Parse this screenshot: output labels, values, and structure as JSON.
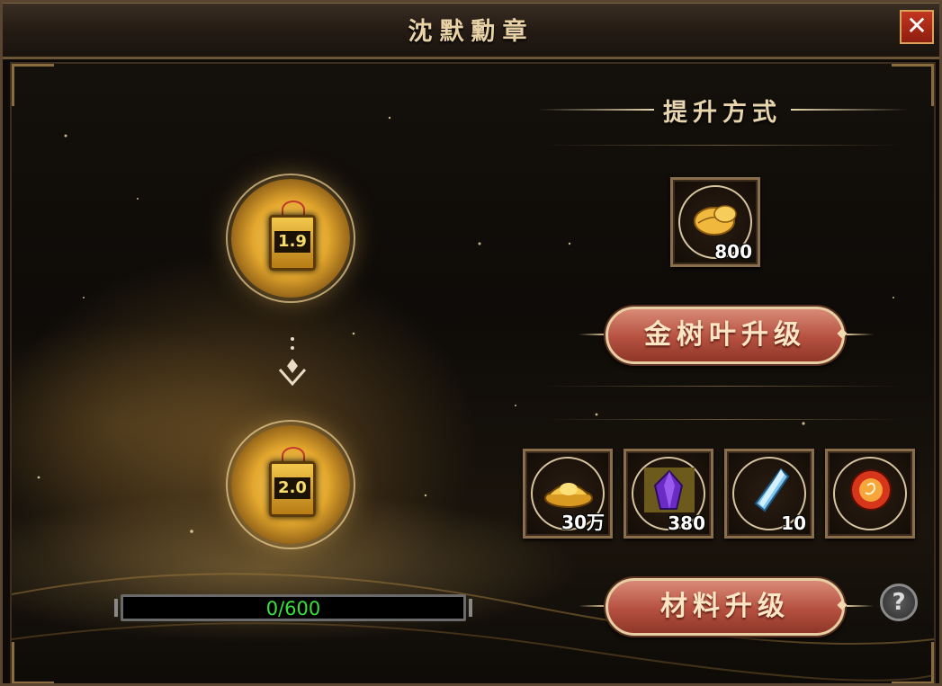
{
  "window": {
    "title": "沈默勳章",
    "close_label": "✕"
  },
  "medal": {
    "current_level": "1.9",
    "next_level": "2.0"
  },
  "progress": {
    "text": "0/600",
    "current": 0,
    "max": 600
  },
  "upgrade_section": {
    "title": "提升方式"
  },
  "gold_leaf": {
    "icon": "gold-leaf-icon",
    "quantity": "800",
    "button_label": "金树叶升级"
  },
  "materials": {
    "items": [
      {
        "icon": "gold-ingot-icon",
        "quantity": "30万"
      },
      {
        "icon": "purple-crystal-icon",
        "quantity": "380"
      },
      {
        "icon": "blue-shard-icon",
        "quantity": "10"
      },
      {
        "icon": "fire-orb-icon",
        "quantity": ""
      }
    ],
    "button_label": "材料升级"
  },
  "help": {
    "label": "?"
  },
  "colors": {
    "accent_gold": "#e8d2a6",
    "button_red": "#b5503f",
    "progress_text": "#38e23a"
  }
}
